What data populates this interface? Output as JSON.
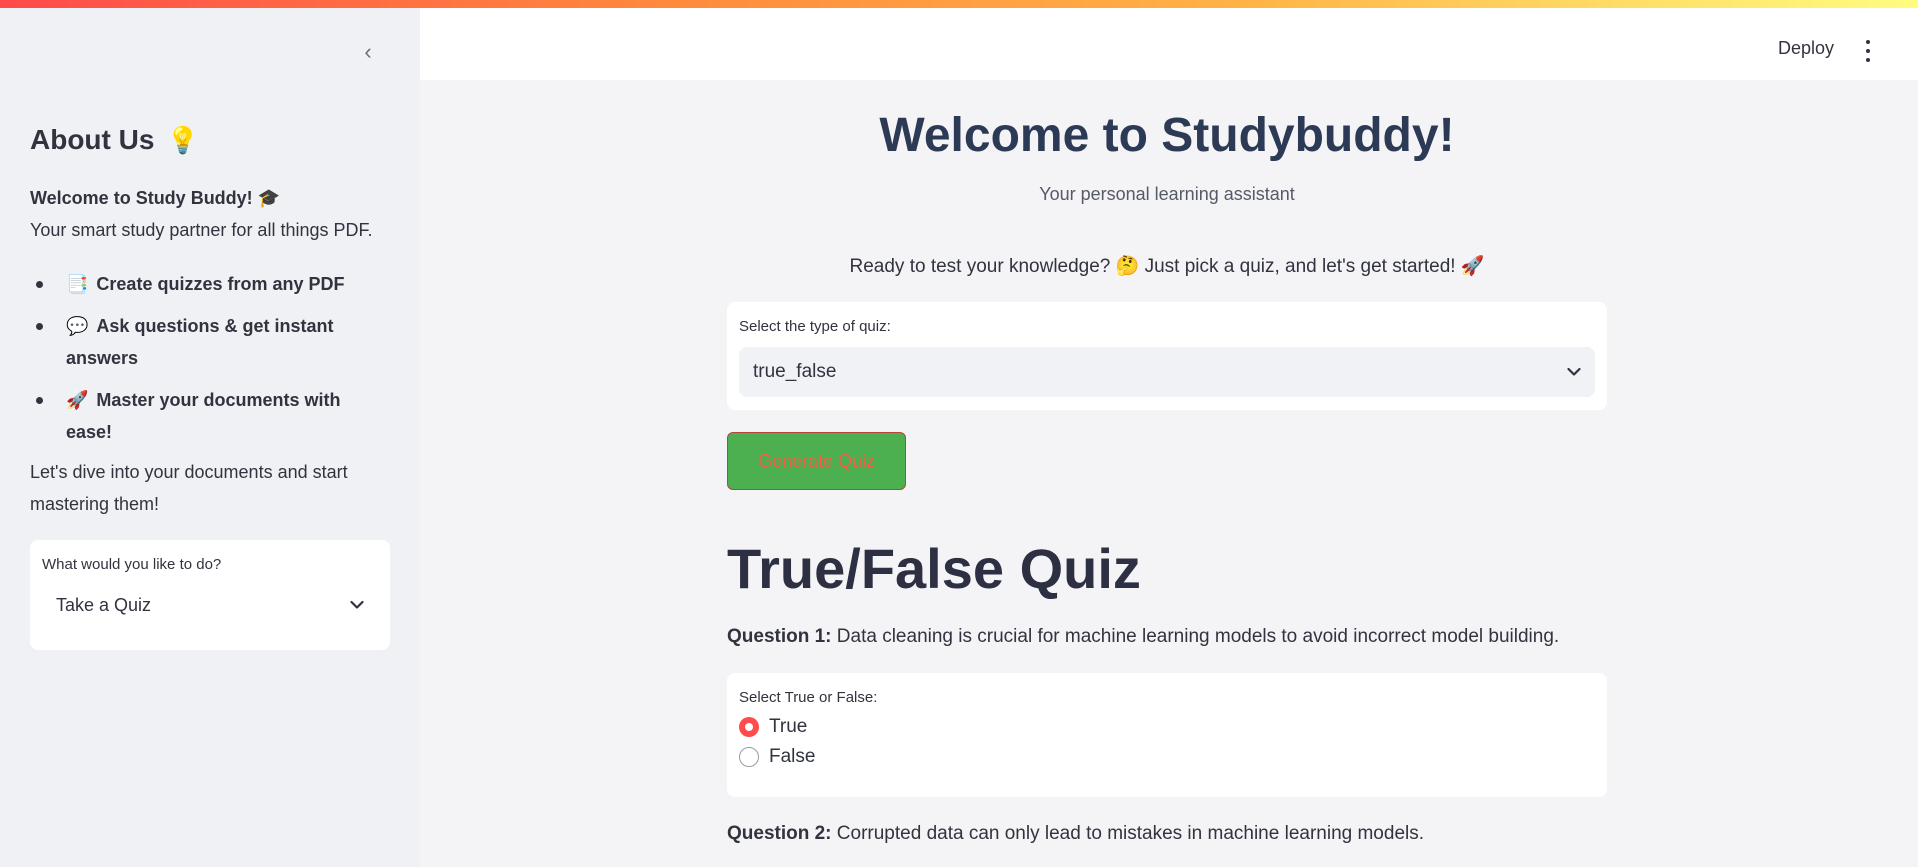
{
  "header": {
    "deploy_label": "Deploy"
  },
  "sidebar": {
    "collapse_icon": "chevron-left-icon",
    "about_title": "About Us",
    "about_emoji": "💡",
    "welcome_line": "Welcome to Study Buddy! 🎓",
    "partner_line": "Your smart study partner for all things PDF.",
    "features": [
      {
        "emoji": "📑",
        "text": "Create quizzes from any PDF"
      },
      {
        "emoji": "💬",
        "text": "Ask questions & get instant answers"
      },
      {
        "emoji": "🚀",
        "text": "Master your documents with ease!"
      }
    ],
    "dive_text": "Let's dive into your documents and start mastering them!",
    "action_label": "What would you like to do?",
    "action_value": "Take a Quiz"
  },
  "main": {
    "title": "Welcome to Studybuddy!",
    "subtitle": "Your personal learning assistant",
    "ready_text": "Ready to test your knowledge? 🤔 Just pick a quiz, and let's get started! 🚀",
    "quiz_type_label": "Select the type of quiz:",
    "quiz_type_value": "true_false",
    "generate_label": "Generate Quiz",
    "quiz_heading": "True/False Quiz",
    "questions": [
      {
        "prefix": "Question 1:",
        "text": "Data cleaning is crucial for machine learning models to avoid incorrect model building.",
        "answer_label": "Select True or False:",
        "options": [
          "True",
          "False"
        ],
        "selected": "True"
      },
      {
        "prefix": "Question 2:",
        "text": "Corrupted data can only lead to mistakes in machine learning models."
      }
    ]
  },
  "colors": {
    "accent": "#ff4b4b",
    "generate_button_bg": "#4caf50",
    "generate_button_text": "#ff5a45",
    "title_color": "#2d3a56"
  }
}
